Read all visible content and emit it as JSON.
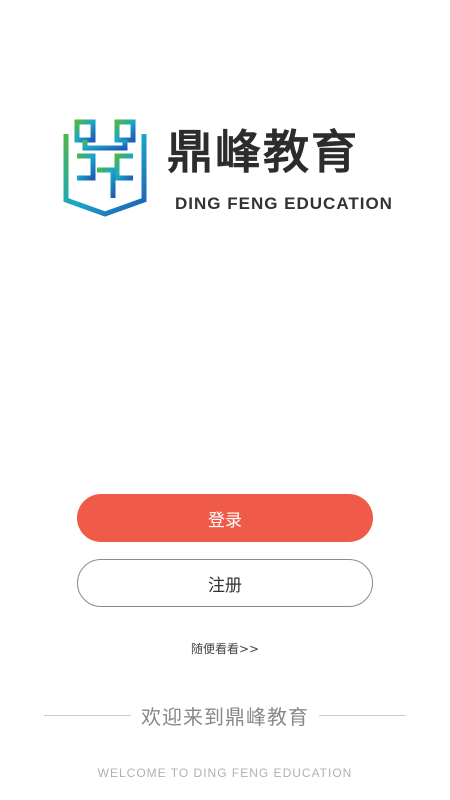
{
  "brand": {
    "name_cn": "鼎峰教育",
    "name_en": "DING FENG EDUCATION",
    "logo_icon": "book-seal-icon",
    "logo_colors": [
      "#49b24a",
      "#1b9fd8",
      "#1e5fb4"
    ]
  },
  "actions": {
    "login_label": "登录",
    "register_label": "注册",
    "browse_label": "随便看看>>"
  },
  "welcome": {
    "title_cn": "欢迎来到鼎峰教育",
    "subtitle_en": "WELCOME TO DING FENG EDUCATION"
  },
  "colors": {
    "accent": "#f05a49",
    "text": "#333333",
    "muted": "#888888"
  }
}
